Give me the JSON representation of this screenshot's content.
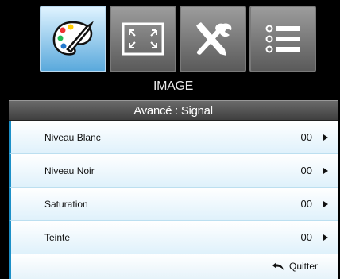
{
  "tabs": [
    {
      "icon": "palette-icon",
      "active": true
    },
    {
      "icon": "screen-resize-icon",
      "active": false
    },
    {
      "icon": "tools-icon",
      "active": false
    },
    {
      "icon": "list-icon",
      "active": false
    }
  ],
  "header": {
    "title": "IMAGE",
    "subtitle": "Avancé : Signal"
  },
  "items": [
    {
      "label": "Niveau Blanc",
      "value": "00"
    },
    {
      "label": "Niveau Noir",
      "value": "00"
    },
    {
      "label": "Saturation",
      "value": "00"
    },
    {
      "label": "Teinte",
      "value": "00"
    }
  ],
  "footer": {
    "quit_label": "Quitter"
  },
  "colors": {
    "accent": "#1c8fc7",
    "active_tab": "#5aa9dc"
  }
}
